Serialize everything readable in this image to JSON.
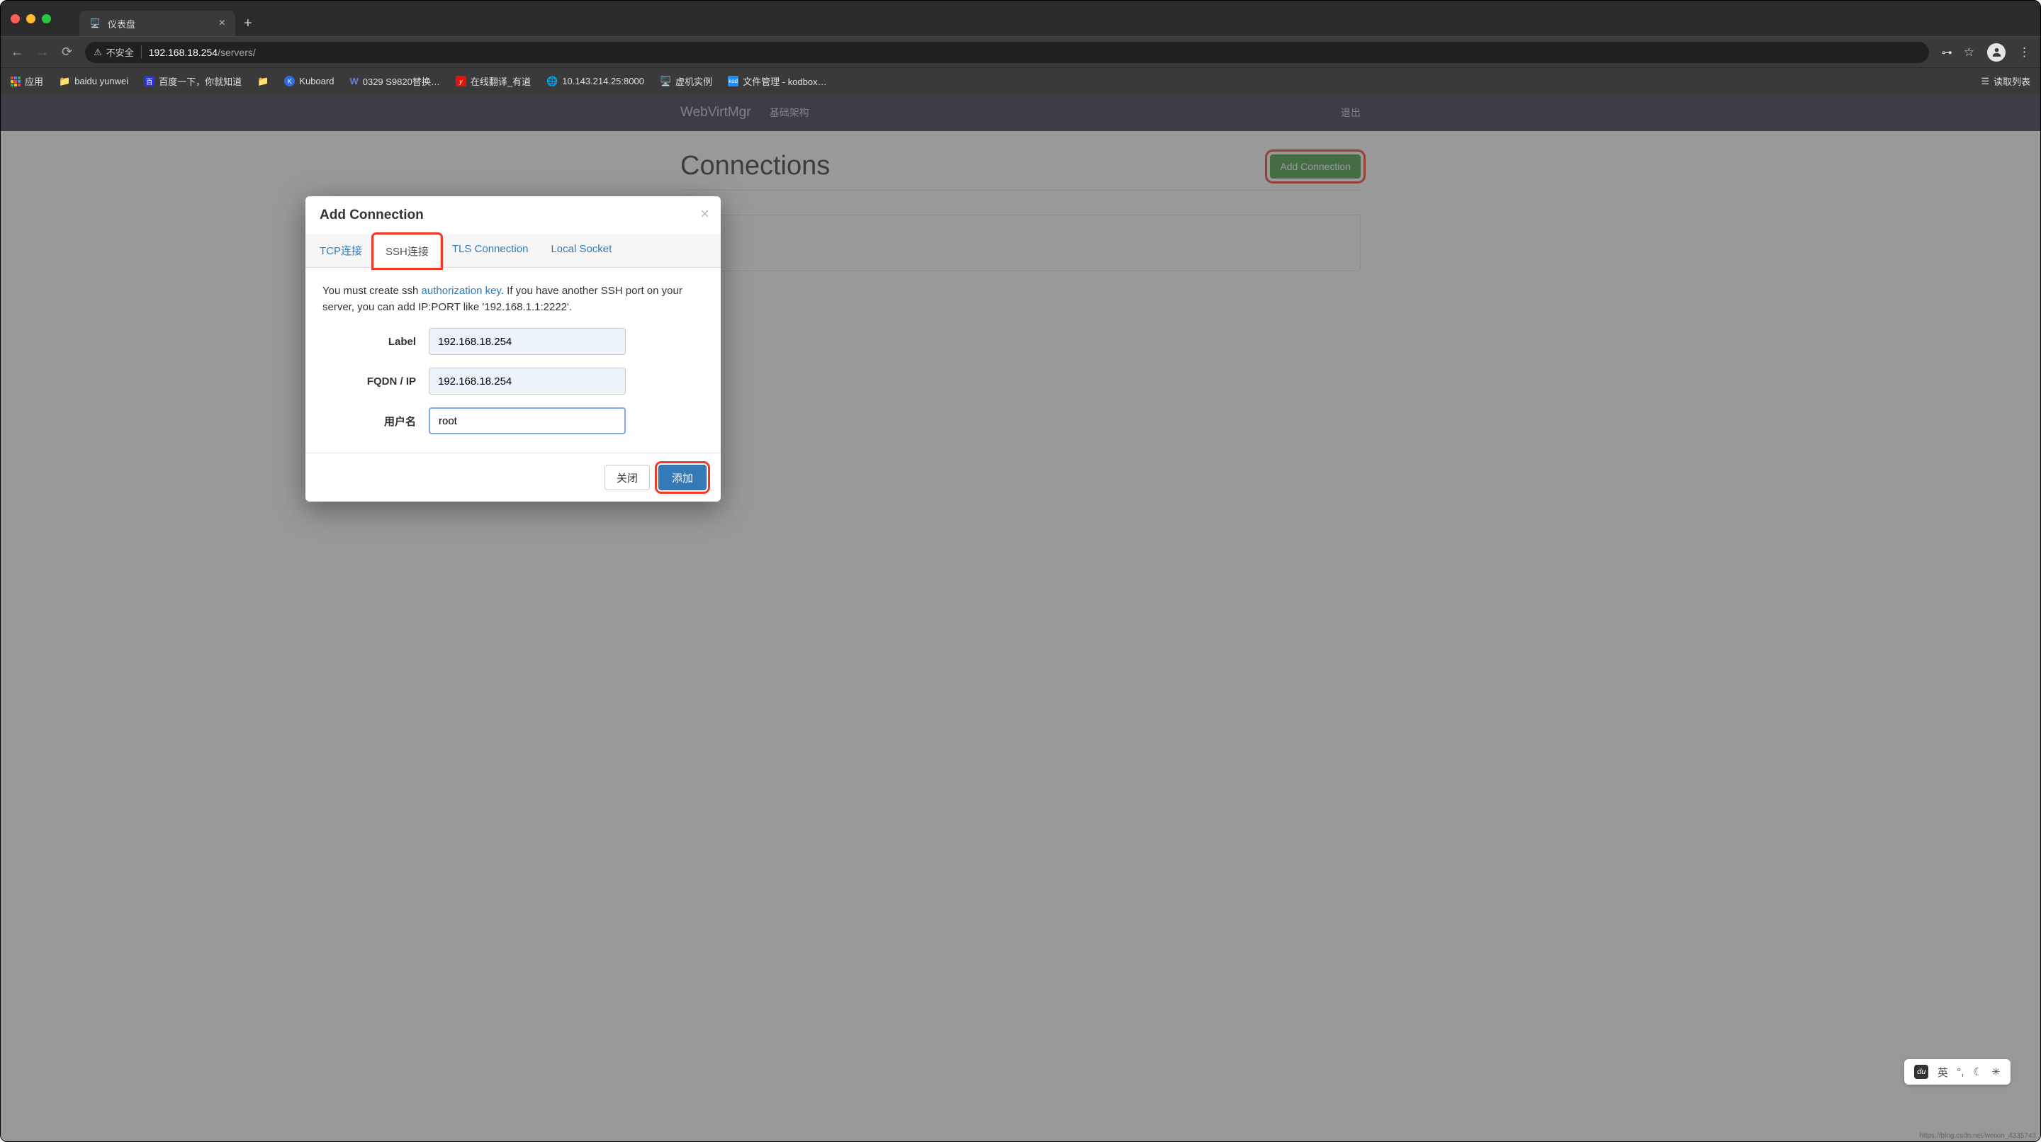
{
  "browser": {
    "tab_title": "仪表盘",
    "not_secure": "不安全",
    "host": "192.168.18.254",
    "path": "/servers/",
    "bookmarks": {
      "apps": "应用",
      "baidu_yunwei": "baidu yunwei",
      "baidu_search": "百度一下，你就知道",
      "kuboard": "Kuboard",
      "s9820": "0329 S9820替换…",
      "youdao": "在线翻译_有道",
      "ipcam": "10.143.214.25:8000",
      "vm_instance": "虚机实例",
      "kodbox": "文件管理 - kodbox…",
      "reading_list": "读取列表"
    }
  },
  "topnav": {
    "brand": "WebVirtMgr",
    "infra": "基础架构",
    "logout": "退出"
  },
  "page": {
    "heading": "Connections",
    "add_button": "Add Connection"
  },
  "modal": {
    "title": "Add Connection",
    "tabs": {
      "tcp": "TCP连接",
      "ssh": "SSH连接",
      "tls": "TLS Connection",
      "local": "Local Socket"
    },
    "info_pre": "You must create ssh ",
    "info_link": "authorization key",
    "info_post": ". If you have another SSH port on your server, you can add IP:PORT like '192.168.1.1:2222'.",
    "fields": {
      "label_label": "Label",
      "label_value": "192.168.18.254",
      "fqdn_label": "FQDN / IP",
      "fqdn_value": "192.168.18.254",
      "user_label": "用户名",
      "user_value": "root"
    },
    "footer": {
      "close": "关闭",
      "add": "添加"
    }
  },
  "ime": {
    "ch": "英"
  },
  "watermark": "https://blog.csdn.net/weixin_4335743"
}
